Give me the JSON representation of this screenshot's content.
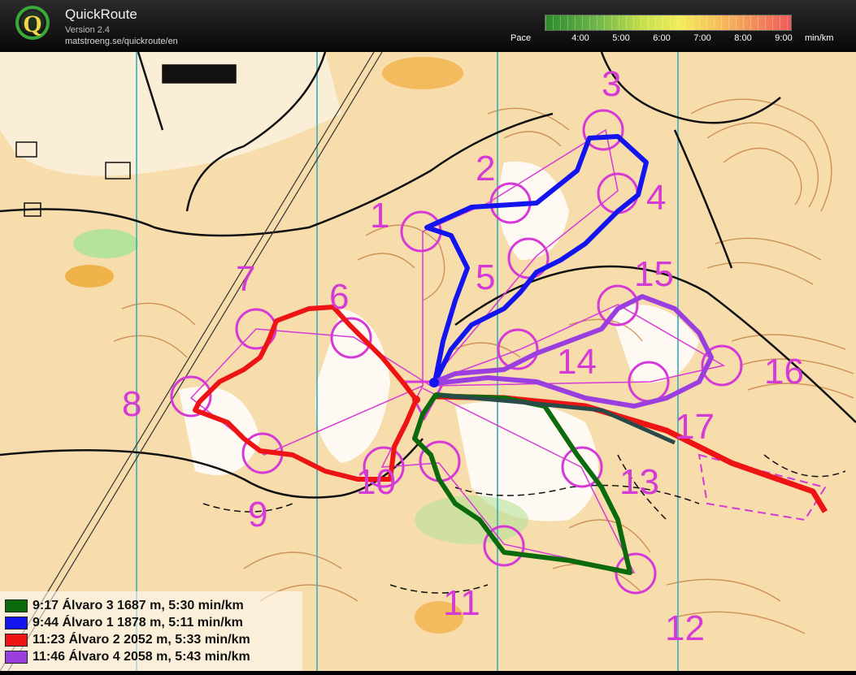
{
  "header": {
    "title": "QuickRoute",
    "version": "Version 2.4",
    "url": "matstroeng.se/quickroute/en",
    "logo_letter": "Q"
  },
  "pace_scale": {
    "label": "Pace",
    "ticks": [
      "4:00",
      "5:00",
      "6:00",
      "7:00",
      "8:00",
      "9:00"
    ],
    "unit": "min/km",
    "colors": [
      "#2a8a2a",
      "#c8e04a",
      "#f2ec5a",
      "#ef5a5a"
    ]
  },
  "map": {
    "background": "#f7dcac",
    "control_color": "#d63ad6",
    "controls": [
      {
        "id": "c1",
        "label": "1"
      },
      {
        "id": "c2",
        "label": "2"
      },
      {
        "id": "c3",
        "label": "3"
      },
      {
        "id": "c4",
        "label": "4"
      },
      {
        "id": "c5",
        "label": "5"
      },
      {
        "id": "c6",
        "label": "6"
      },
      {
        "id": "c7",
        "label": "7"
      },
      {
        "id": "c8",
        "label": "8"
      },
      {
        "id": "c9",
        "label": "9"
      },
      {
        "id": "c10",
        "label": "10"
      },
      {
        "id": "c11",
        "label": "11"
      },
      {
        "id": "c12",
        "label": "12"
      },
      {
        "id": "c13",
        "label": "13"
      },
      {
        "id": "c14",
        "label": "14"
      },
      {
        "id": "c15",
        "label": "15"
      },
      {
        "id": "c16",
        "label": "16"
      },
      {
        "id": "c17",
        "label": "17"
      }
    ]
  },
  "legend": {
    "items": [
      {
        "color": "#0b6a0b",
        "text": "9:17 Álvaro 3 1687 m, 5:30 min/km"
      },
      {
        "color": "#1414ee",
        "text": "9:44 Álvaro 1 1878 m, 5:11 min/km"
      },
      {
        "color": "#ee1414",
        "text": "11:23 Álvaro 2 2052 m, 5:33 min/km"
      },
      {
        "color": "#9a3ee0",
        "text": "11:46 Álvaro 4 2058 m, 5:43 min/km"
      }
    ]
  }
}
